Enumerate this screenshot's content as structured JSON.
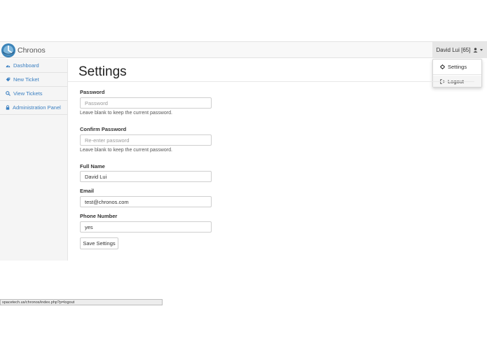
{
  "app": {
    "brand": "Chronos"
  },
  "user_menu": {
    "label": "David Lui [65]",
    "icon": "user-icon"
  },
  "dropdown": {
    "items": [
      {
        "label": "Settings",
        "icon": "gear-icon"
      },
      {
        "label": "Logout",
        "icon": "sign-out-icon"
      }
    ]
  },
  "sidebar": {
    "items": [
      {
        "label": "Dashboard",
        "icon": "dashboard-icon"
      },
      {
        "label": "New Ticket",
        "icon": "tag-icon"
      },
      {
        "label": "View Tickets",
        "icon": "search-icon"
      },
      {
        "label": "Administration Panel",
        "icon": "lock-icon"
      }
    ]
  },
  "page": {
    "title": "Settings"
  },
  "form": {
    "password": {
      "label": "Password",
      "placeholder": "Password",
      "help": "Leave blank to keep the current password."
    },
    "confirm": {
      "label": "Confirm Password",
      "placeholder": "Re-enter password",
      "help": "Leave blank to keep the current password."
    },
    "fullname": {
      "label": "Full Name",
      "value": "David Lui"
    },
    "email": {
      "label": "Email",
      "value": "test@chronos.com"
    },
    "phone": {
      "label": "Phone Number",
      "value": "yes"
    },
    "save_label": "Save Settings"
  },
  "status_bar": {
    "url": "spacetech.us/chronos/index.php?p=logout"
  },
  "colors": {
    "link": "#3a7fc1",
    "navbar_bg": "#f8f8f8",
    "sidebar_bg": "#f5f5f5"
  }
}
